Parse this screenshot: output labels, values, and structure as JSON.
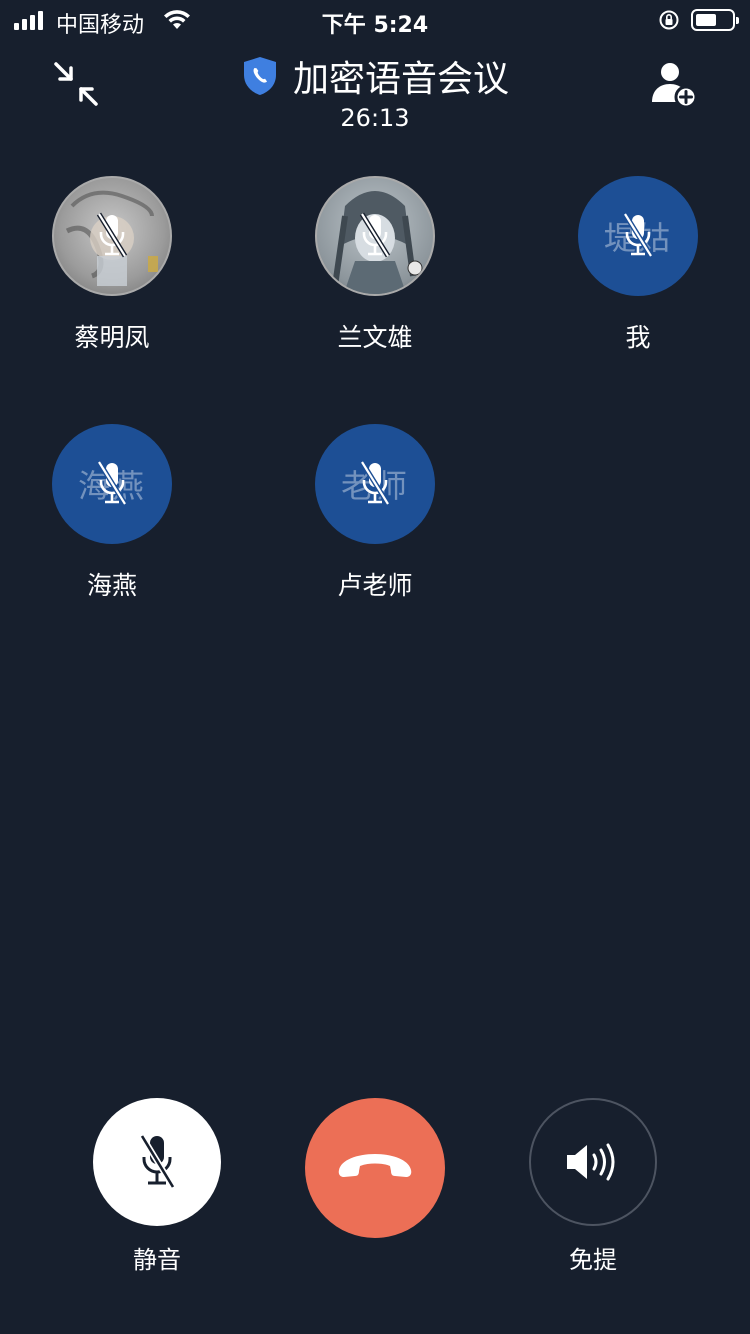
{
  "status_bar": {
    "carrier": "中国移动",
    "time": "下午 5:24"
  },
  "header": {
    "title": "加密语音会议",
    "duration": "26:13",
    "shield_color": "#3f7fe0"
  },
  "participants": [
    {
      "name": "蔡明凤",
      "avatar_type": "photo",
      "avatar_text": "",
      "muted": true
    },
    {
      "name": "兰文雄",
      "avatar_type": "photo",
      "avatar_text": "",
      "muted": true
    },
    {
      "name": "我",
      "avatar_type": "text",
      "avatar_text": "堤姑",
      "muted": true
    },
    {
      "name": "海燕",
      "avatar_type": "text",
      "avatar_text": "海燕",
      "muted": true
    },
    {
      "name": "卢老师",
      "avatar_type": "text",
      "avatar_text": "老师",
      "muted": true
    }
  ],
  "controls": {
    "mute_label": "静音",
    "hangup_color": "#ec6f56",
    "speaker_label": "免提"
  },
  "colors": {
    "background": "#171f2d",
    "avatar_blue": "#1d4f95"
  }
}
